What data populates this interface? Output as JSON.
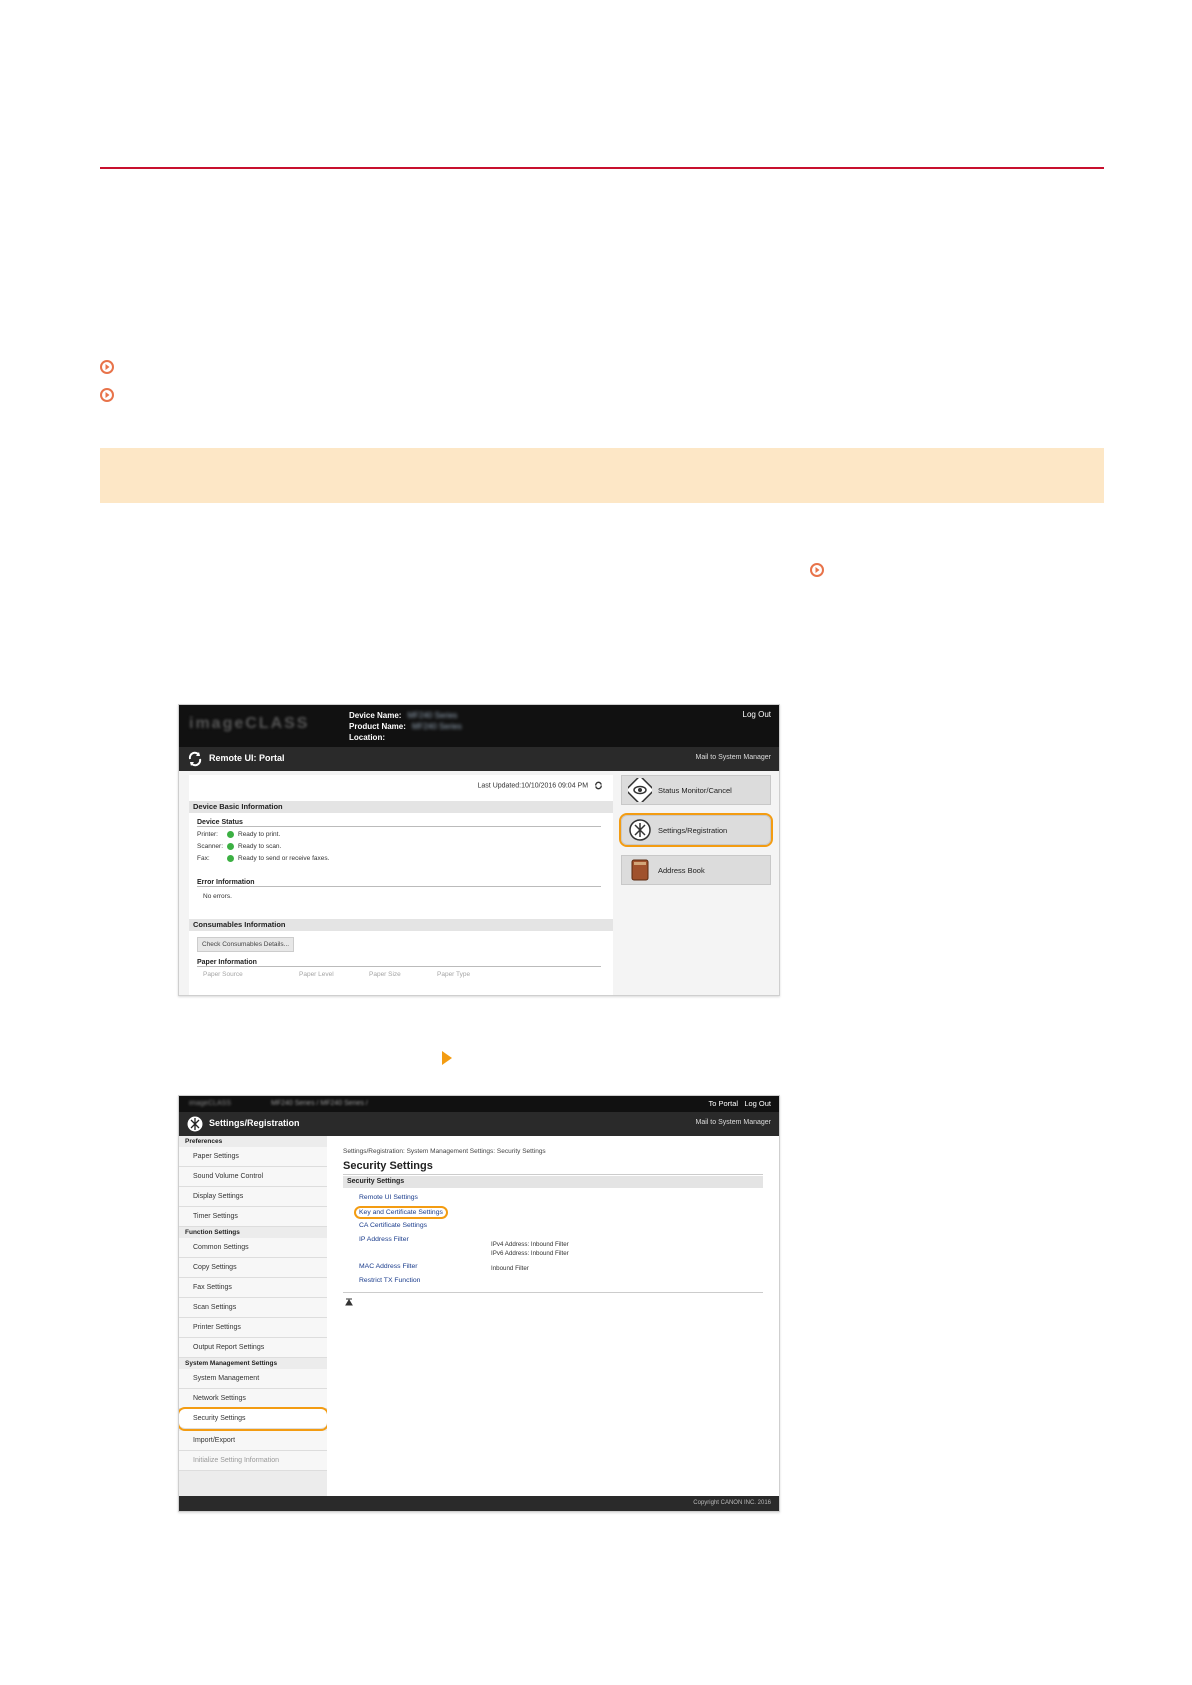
{
  "screenshot1": {
    "device_labels": [
      "Device Name:",
      "Product Name:",
      "Location:"
    ],
    "device_name": "MF240 Series",
    "product_name": "MF240 Series",
    "logout": "Log Out",
    "bar_title": "Remote UI: Portal",
    "mail": "Mail to System Manager",
    "last_updated": "Last Updated:10/10/2016 09:04 PM",
    "basic_info": "Device Basic Information",
    "device_status": "Device Status",
    "status_rows": [
      {
        "label": "Printer:",
        "value": "Ready to print."
      },
      {
        "label": "Scanner:",
        "value": "Ready to scan."
      },
      {
        "label": "Fax:",
        "value": "Ready to send or receive faxes."
      }
    ],
    "error_info": "Error Information",
    "no_errors": "No errors.",
    "consumables": "Consumables Information",
    "check_button": "Check Consumables Details...",
    "paper_info": "Paper Information",
    "paper_cols": [
      "Paper Source",
      "Paper Level",
      "Paper Size",
      "Paper Type"
    ],
    "side_buttons": [
      "Status Monitor/Cancel",
      "Settings/Registration",
      "Address Book"
    ]
  },
  "screenshot2": {
    "breadcrumb_top": "MF240 Series / MF240 Series /",
    "to_portal": "To Portal",
    "logout": "Log Out",
    "bar_title": "Settings/Registration",
    "mail": "Mail to System Manager",
    "groups": [
      "Preferences",
      "Function Settings",
      "System Management Settings"
    ],
    "preferences": [
      "Paper Settings",
      "Sound Volume Control",
      "Display Settings",
      "Timer Settings"
    ],
    "function": [
      "Common Settings",
      "Copy Settings",
      "Fax Settings",
      "Scan Settings",
      "Printer Settings",
      "Output Report Settings"
    ],
    "system": [
      "System Management",
      "Network Settings",
      "Security Settings",
      "Import/Export",
      "Initialize Setting Information"
    ],
    "crumb": "Settings/Registration: System Management Settings: Security Settings",
    "page_title": "Security Settings",
    "section": "Security Settings",
    "links": [
      "Remote UI Settings",
      "Key and Certificate Settings",
      "CA Certificate Settings",
      "IP Address Filter",
      "MAC Address Filter",
      "Restrict TX Function"
    ],
    "ip_values": [
      "IPv4 Address: Inbound Filter",
      "IPv6 Address: Inbound Filter"
    ],
    "mac_value": "Inbound Filter",
    "copyright": "Copyright CANON INC. 2016"
  }
}
